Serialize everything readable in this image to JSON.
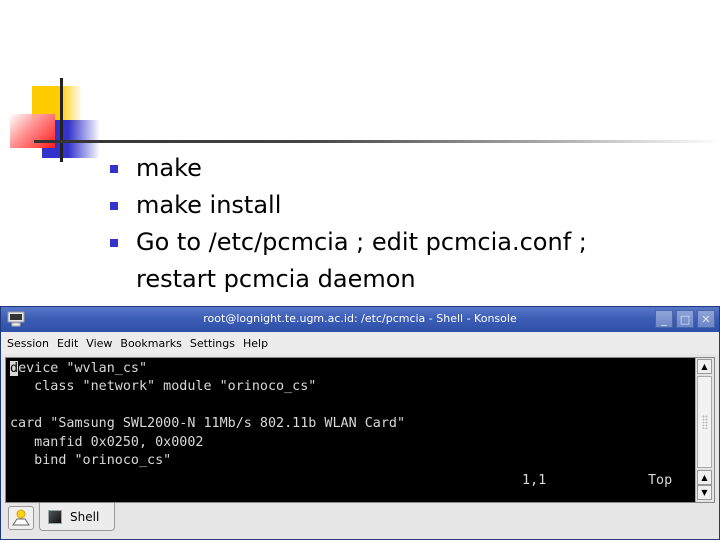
{
  "slide": {
    "bullets": [
      "make",
      "make install",
      "Go to /etc/pcmcia ; edit pcmcia.conf ;",
      "restart pcmcia daemon"
    ],
    "accent_colors": {
      "yellow": "#ffcc00",
      "red": "#ff1a1a",
      "blue": "#3333cc"
    }
  },
  "window": {
    "title": "root@lognight.te.ugm.ac.id: /etc/pcmcia - Shell - Konsole",
    "icon": "terminal-monitor-icon",
    "controls": {
      "minimize": "_",
      "maximize": "□",
      "close": "✕"
    },
    "menu": [
      "Session",
      "Edit",
      "View",
      "Bookmarks",
      "Settings",
      "Help"
    ]
  },
  "terminal": {
    "cursor_char": "d",
    "line1_rest": "evice \"wvlan_cs\"",
    "line2": "   class \"network\" module \"orinoco_cs\"",
    "line3": "",
    "line4": "card \"Samsung SWL2000-N 11Mb/s 802.11b WLAN Card\"",
    "line5": "   manfid 0x0250, 0x0002",
    "line6": "   bind \"orinoco_cs\"",
    "cursor_position": "1,1",
    "scroll_position": "Top"
  },
  "tabs": {
    "new_tab_icon": "new-session-icon",
    "items": [
      {
        "label": "Shell"
      }
    ]
  }
}
